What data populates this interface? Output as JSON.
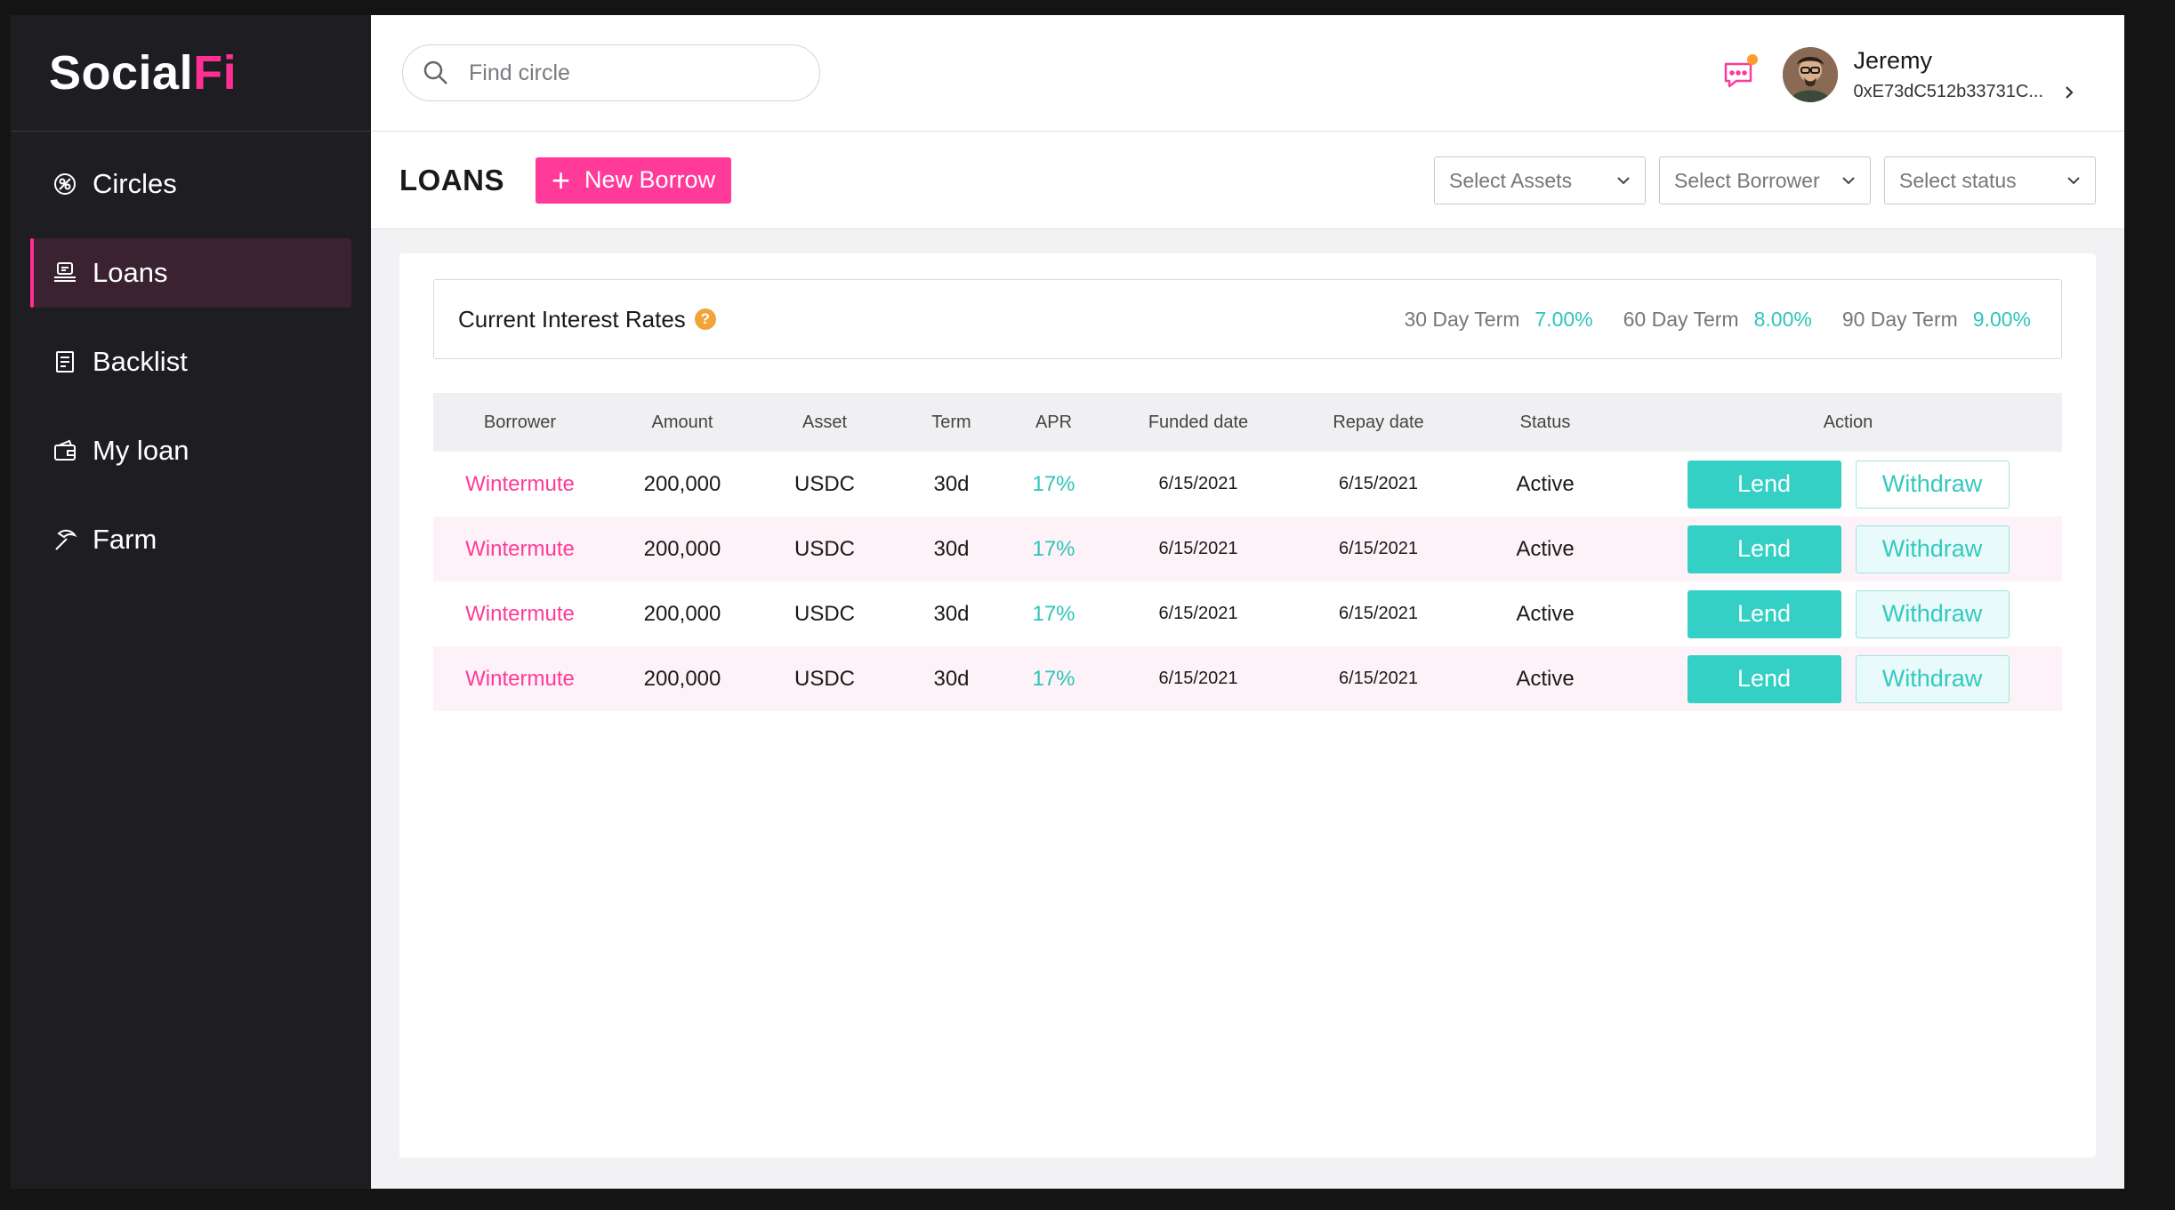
{
  "app": {
    "logo_main": "Social",
    "logo_accent": "Fi"
  },
  "sidebar": {
    "items": [
      {
        "label": "Circles",
        "icon": "circles-icon",
        "active": false
      },
      {
        "label": "Loans",
        "icon": "loans-icon",
        "active": true
      },
      {
        "label": "Backlist",
        "icon": "backlist-icon",
        "active": false
      },
      {
        "label": "My loan",
        "icon": "wallet-icon",
        "active": false
      },
      {
        "label": "Farm",
        "icon": "pickaxe-icon",
        "active": false
      }
    ]
  },
  "header": {
    "search_placeholder": "Find circle",
    "user_name": "Jeremy",
    "user_address": "0xE73dC512b33731C..."
  },
  "toolbar": {
    "title": "LOANS",
    "new_borrow_label": "New Borrow",
    "filters": [
      "Select Assets",
      "Select Borrower",
      "Select status"
    ]
  },
  "rates": {
    "title": "Current Interest Rates",
    "help": "?",
    "terms": [
      {
        "label": "30 Day Term",
        "value": "7.00%"
      },
      {
        "label": "60 Day Term",
        "value": "8.00%"
      },
      {
        "label": "90 Day Term",
        "value": "9.00%"
      }
    ]
  },
  "table": {
    "columns": [
      "Borrower",
      "Amount",
      "Asset",
      "Term",
      "APR",
      "Funded date",
      "Repay date",
      "Status",
      "Action"
    ],
    "lend_label": "Lend",
    "withdraw_label": "Withdraw",
    "rows": [
      {
        "borrower": "Wintermute",
        "amount": "200,000",
        "asset": "USDC",
        "term": "30d",
        "apr": "17%",
        "funded": "6/15/2021",
        "repay": "6/15/2021",
        "status": "Active"
      },
      {
        "borrower": "Wintermute",
        "amount": "200,000",
        "asset": "USDC",
        "term": "30d",
        "apr": "17%",
        "funded": "6/15/2021",
        "repay": "6/15/2021",
        "status": "Active"
      },
      {
        "borrower": "Wintermute",
        "amount": "200,000",
        "asset": "USDC",
        "term": "30d",
        "apr": "17%",
        "funded": "6/15/2021",
        "repay": "6/15/2021",
        "status": "Active"
      },
      {
        "borrower": "Wintermute",
        "amount": "200,000",
        "asset": "USDC",
        "term": "30d",
        "apr": "17%",
        "funded": "6/15/2021",
        "repay": "6/15/2021",
        "status": "Active"
      }
    ]
  },
  "colors": {
    "accent_pink": "#ff3a99",
    "accent_teal": "#34cfc5",
    "sidebar_bg": "#1e1d21"
  }
}
